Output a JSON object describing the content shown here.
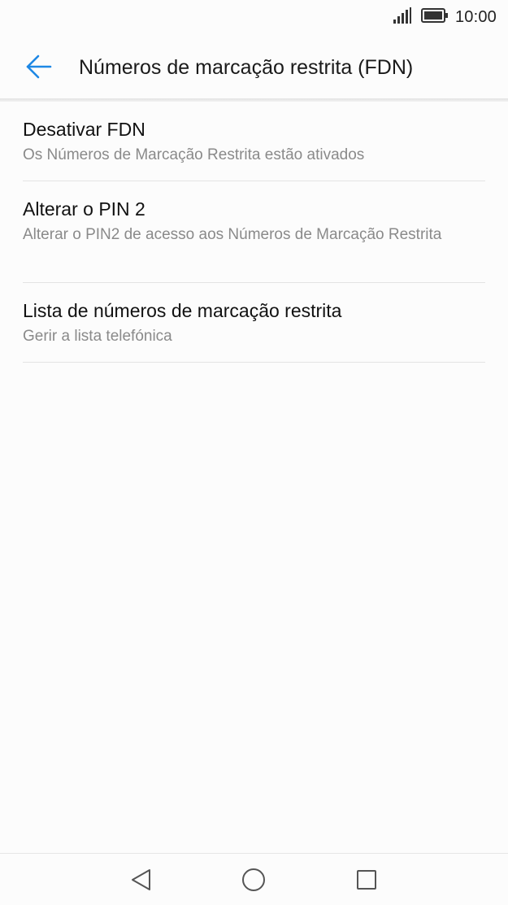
{
  "status_bar": {
    "time": "10:00",
    "signal_icon": "signal-icon",
    "battery_icon": "battery-icon"
  },
  "app_bar": {
    "back_icon": "back-arrow-icon",
    "title": "Números de marcação restrita (FDN)",
    "accent_color": "#1e88e5"
  },
  "list": {
    "items": [
      {
        "title": "Desativar FDN",
        "subtitle": "Os Números de Marcação Restrita estão ativados"
      },
      {
        "title": "Alterar o PIN 2",
        "subtitle": "Alterar o PIN2 de acesso aos Números de Marcação Restrita"
      },
      {
        "title": "Lista de números de marcação restrita",
        "subtitle": "Gerir a lista telefónica"
      }
    ]
  },
  "nav_bar": {
    "back_icon": "nav-back-icon",
    "home_icon": "nav-home-icon",
    "recents_icon": "nav-recents-icon"
  }
}
